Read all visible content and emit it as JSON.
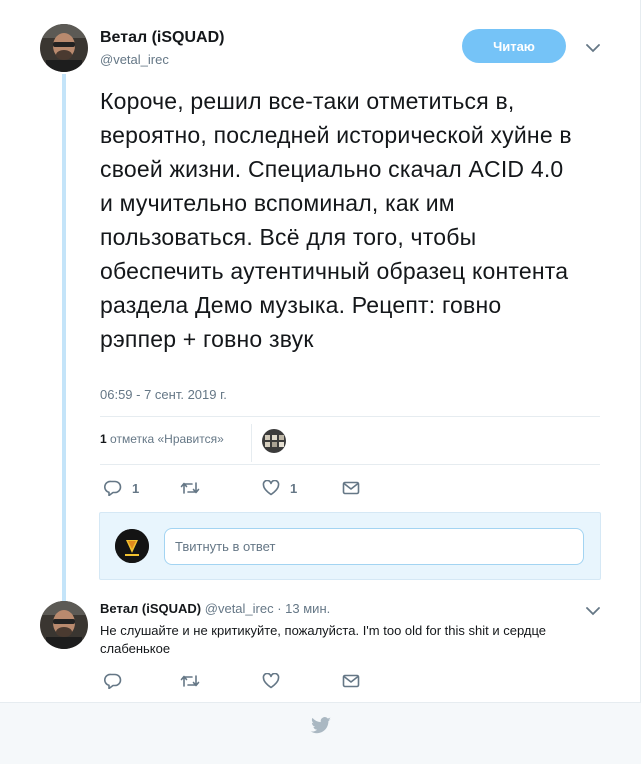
{
  "tweet": {
    "author_name": "Ветал (iSQUAD)",
    "author_handle": "@vetal_irec",
    "follow_label": "Читаю",
    "text": "Короче, решил все-таки отметиться в, вероятно, последней исторической хуйне в своей жизни. Специально скачал ACID 4.0 и мучительно вспоминал, как им пользоваться. Всё для того, чтобы обеспечить аутентичный образец контента раздела Демо музыка. Рецепт: говно рэппер + говно звук",
    "timestamp": "06:59 - 7 сент. 2019 г.",
    "likes_count": "1",
    "likes_label": "отметка «Нравится»",
    "reply_count": "1",
    "retweet_count": "",
    "like_count": "1"
  },
  "reply_box": {
    "placeholder": "Твитнуть в ответ"
  },
  "reply": {
    "author_name": "Ветал (iSQUAD)",
    "author_handle": "@vetal_irec",
    "time": "· 13 мин.",
    "text": "Не слушайте и не критикуйте, пожалуйста. I'm too old for this shit и сердце слабенькое"
  },
  "colors": {
    "accent": "#1da1f2",
    "follow_bg": "#75c3f7",
    "thread_line": "#c4e4f9",
    "muted": "#657786"
  },
  "icons": [
    "chevron-down-icon",
    "reply-icon",
    "retweet-icon",
    "heart-icon",
    "message-icon",
    "twitter-bird-icon"
  ]
}
